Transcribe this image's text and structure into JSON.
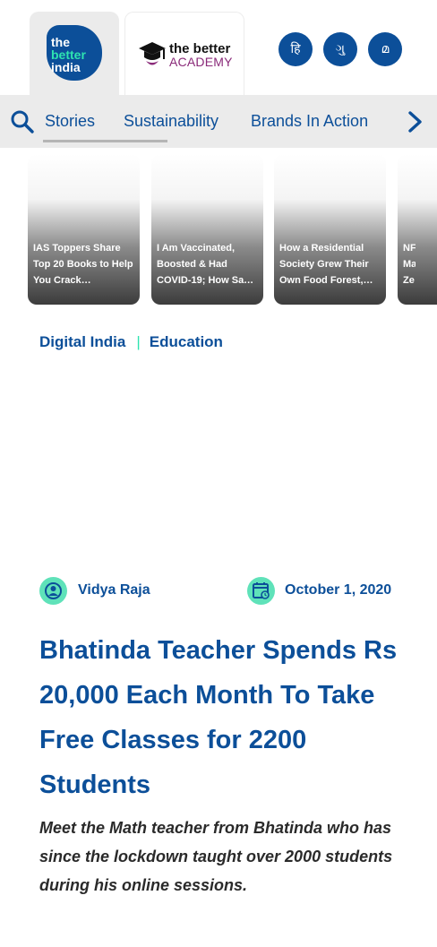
{
  "brand": {
    "logo_lines": [
      "the",
      "better",
      "india"
    ],
    "academy_top": "the better",
    "academy_bottom": "ACADEMY"
  },
  "language_buttons": [
    {
      "label": "हि",
      "name": "hindi"
    },
    {
      "label": "ગુ",
      "name": "gujarati"
    },
    {
      "label": "മ",
      "name": "malayalam"
    }
  ],
  "nav": {
    "search_icon": "search-icon",
    "items": [
      "Stories",
      "Sustainability",
      "Brands In Action"
    ],
    "next_icon": "chevron-right-icon"
  },
  "story_cards": [
    {
      "title": "IAS Toppers Share Top 20 Books to Help You Crack…"
    },
    {
      "title": "I Am Vaccinated, Boosted & Had COVID-19; How Sa…"
    },
    {
      "title": "How a Residential Society Grew Their Own Food Forest,…"
    },
    {
      "title": "NF Ma Ze"
    }
  ],
  "categories": [
    "Digital India",
    "Education"
  ],
  "article": {
    "author": "Vidya Raja",
    "author_icon": "user-icon",
    "date": "October 1, 2020",
    "date_icon": "calendar-icon",
    "headline": "Bhatinda Teacher Spends Rs 20,000 Each Month To Take Free Classes for 2200 Students",
    "excerpt": "Meet the Math teacher from Bhatinda who has since the lockdown taught over 2000 students during his online sessions."
  },
  "colors": {
    "primary": "#0c4f99",
    "accent": "#2ee3b0",
    "nav_bg": "#ebebeb",
    "academy": "#8a2a79"
  }
}
